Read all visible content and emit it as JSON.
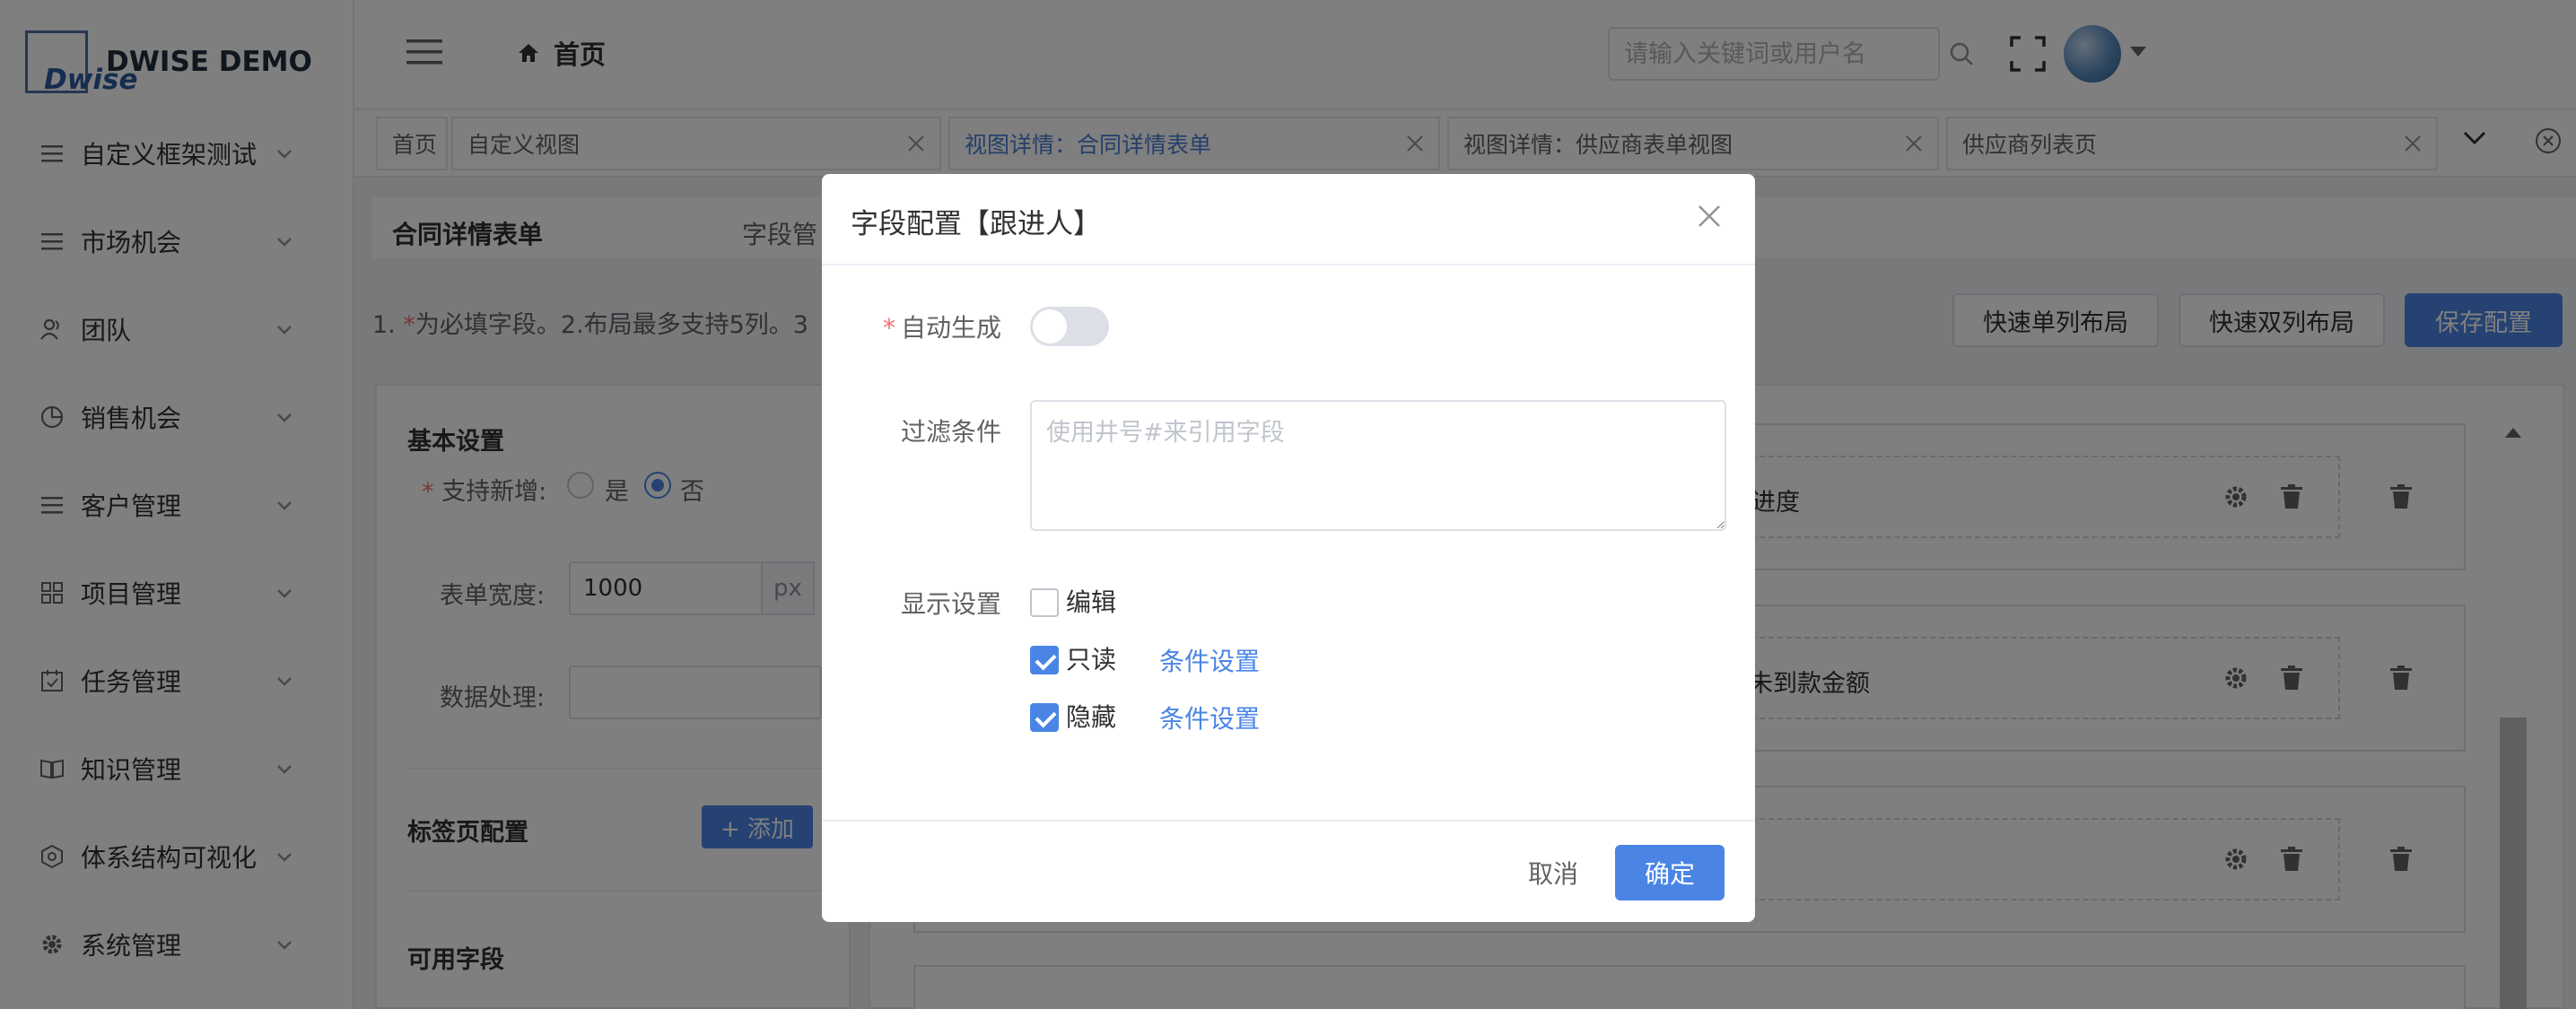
{
  "brand": {
    "logo_text": "Dwise",
    "name": "DWISE DEMO"
  },
  "sidebar": {
    "items": [
      {
        "label": "自定义框架测试",
        "icon": "list-icon"
      },
      {
        "label": "市场机会",
        "icon": "list-icon"
      },
      {
        "label": "团队",
        "icon": "team-icon"
      },
      {
        "label": "销售机会",
        "icon": "pie-icon"
      },
      {
        "label": "客户管理",
        "icon": "list-icon"
      },
      {
        "label": "项目管理",
        "icon": "grid-icon"
      },
      {
        "label": "任务管理",
        "icon": "calendar-check-icon"
      },
      {
        "label": "知识管理",
        "icon": "book-icon"
      },
      {
        "label": "体系结构可视化",
        "icon": "hexagon-icon"
      },
      {
        "label": "系统管理",
        "icon": "gear-icon"
      }
    ]
  },
  "header": {
    "breadcrumb": "首页",
    "search_placeholder": "请输入关键词或用户名"
  },
  "tabs": [
    {
      "label": "首页",
      "closable": false
    },
    {
      "label": "自定义视图",
      "closable": true
    },
    {
      "label": "视图详情：合同详情表单",
      "closable": true,
      "active": true
    },
    {
      "label": "视图详情：供应商表单视图",
      "closable": true
    },
    {
      "label": "供应商列表页",
      "closable": true
    }
  ],
  "main": {
    "title": "合同详情表单",
    "subtitle": "字段管",
    "hint_prefix": "1. ",
    "hint_star": "*",
    "hint_rest": "为必填字段。2.布局最多支持5列。3",
    "buttons": {
      "single": "快速单列布局",
      "double": "快速双列布局",
      "save": "保存配置"
    },
    "basic": {
      "title": "基本设置",
      "allow_add_label": "支持新增:",
      "yes": "是",
      "no": "否",
      "width_label": "表单宽度:",
      "width_value": "1000",
      "width_unit": "px",
      "data_label": "数据处理:"
    },
    "tab_config": {
      "title": "标签页配置",
      "add": "+ 添加"
    },
    "available_title": "可用字段",
    "fields": [
      {
        "label": "进度"
      },
      {
        "label": "累未到款金额"
      },
      {
        "label": ""
      }
    ]
  },
  "dialog": {
    "title": "字段配置【跟进人】",
    "auto_label": "自动生成",
    "filter_label": "过滤条件",
    "filter_placeholder": "使用井号#来引用字段",
    "display_label": "显示设置",
    "options": [
      {
        "label": "编辑",
        "checked": false
      },
      {
        "label": "只读",
        "checked": true,
        "link": "条件设置"
      },
      {
        "label": "隐藏",
        "checked": true,
        "link": "条件设置"
      }
    ],
    "cancel": "取消",
    "ok": "确定"
  },
  "colors": {
    "primary": "#4a85e6",
    "required": "#f56c6c"
  }
}
